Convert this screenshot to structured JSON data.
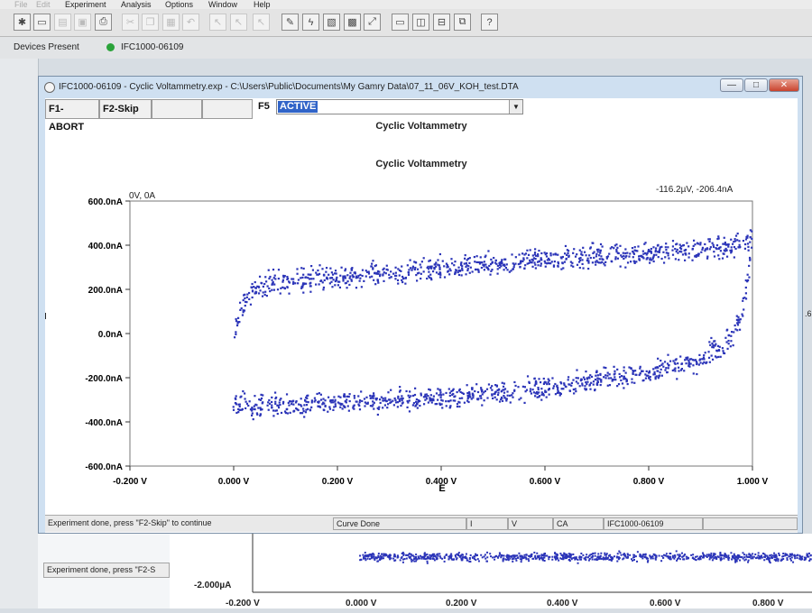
{
  "menubar": {
    "items": [
      "File",
      "Edit",
      "Experiment",
      "Analysis",
      "Options",
      "Window",
      "Help"
    ]
  },
  "devices": {
    "label": "Devices Present",
    "device": "IFC1000-06109",
    "status_color": "#2aa33a"
  },
  "window": {
    "title": "IFC1000-06109 - Cyclic Voltammetry.exp - C:\\Users\\Public\\Documents\\My Gamry Data\\07_11_06V_KOH_test.DTA",
    "min_label": "—",
    "max_label": "□",
    "close_label": "✕"
  },
  "fkeys": {
    "f1": "F1-ABORT",
    "f2": "F2-Skip",
    "f5_label": "F5",
    "f5_value": "ACTIVE"
  },
  "plot_header": "Cyclic Voltammetry",
  "status": {
    "message": "Experiment done, press \"F2-Skip\" to continue",
    "curve": "Curve Done",
    "i": "I",
    "v": "V",
    "mode": "CA",
    "device": "IFC1000-06109"
  },
  "background": {
    "status": "Experiment done, press \"F2-S",
    "ylabel": "-2.000µA",
    "xticks": [
      "-0.200 V",
      "0.000 V",
      "0.200 V",
      "0.400 V",
      "0.600 V",
      "0.800 V"
    ],
    "edge_value": ".6"
  },
  "chart_data": {
    "type": "scatter",
    "title": "Cyclic Voltammetry",
    "xlabel": "E",
    "ylabel": "I",
    "xlim": [
      -0.2,
      1.0
    ],
    "ylim": [
      -600,
      600
    ],
    "x_unit": "V",
    "y_unit": "nA",
    "x_ticks": [
      "-0.200 V",
      "0.000 V",
      "0.200 V",
      "0.400 V",
      "0.600 V",
      "0.800 V",
      "1.000 V"
    ],
    "y_ticks": [
      "600.0nA",
      "400.0nA",
      "200.0nA",
      "0.0nA",
      "-200.0nA",
      "-400.0nA",
      "-600.0nA"
    ],
    "cursor_start": "0V, 0A",
    "cursor_end": "-116.2µV, -206.4nA",
    "marker_color": "#2b34b8",
    "grid": false,
    "series": [
      {
        "branch": "anodic (forward sweep)",
        "x": [
          0.0,
          0.01,
          0.02,
          0.04,
          0.06,
          0.1,
          0.15,
          0.2,
          0.3,
          0.4,
          0.5,
          0.6,
          0.7,
          0.8,
          0.9,
          0.95,
          1.0
        ],
        "y": [
          0,
          70,
          140,
          190,
          215,
          235,
          250,
          255,
          275,
          295,
          315,
          335,
          350,
          365,
          385,
          395,
          420
        ]
      },
      {
        "branch": "cathodic (reverse sweep)",
        "x": [
          1.0,
          0.99,
          0.98,
          0.96,
          0.94,
          0.9,
          0.85,
          0.8,
          0.7,
          0.6,
          0.5,
          0.4,
          0.3,
          0.2,
          0.1,
          0.05,
          0.0
        ],
        "y": [
          420,
          250,
          90,
          -10,
          -60,
          -110,
          -150,
          -175,
          -210,
          -245,
          -270,
          -290,
          -300,
          -310,
          -320,
          -325,
          -330
        ]
      }
    ]
  }
}
